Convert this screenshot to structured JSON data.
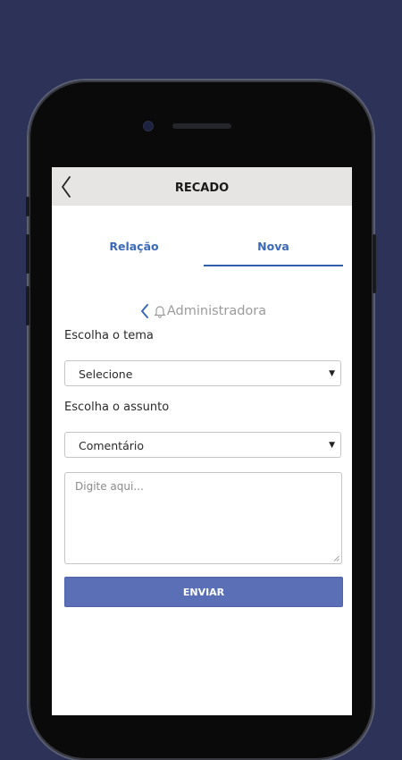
{
  "appbar": {
    "title": "RECADO",
    "back_icon": "chevron-left-icon"
  },
  "tabs": [
    {
      "label": "Relação",
      "active": false
    },
    {
      "label": "Nova",
      "active": true
    }
  ],
  "recipient": {
    "label": "Administradora",
    "back_icon": "chevron-left-icon",
    "icon": "bell-icon"
  },
  "form": {
    "tema_label": "Escolha o tema",
    "tema_value": "Selecione",
    "assunto_label": "Escolha o assunto",
    "assunto_value": "Comentário",
    "message_placeholder": "Digite aqui...",
    "send_label": "ENVIAR"
  },
  "colors": {
    "background": "#2c3258",
    "accent": "#3a69b6",
    "button": "#5a6fb6",
    "appbar": "#e6e5e4"
  }
}
